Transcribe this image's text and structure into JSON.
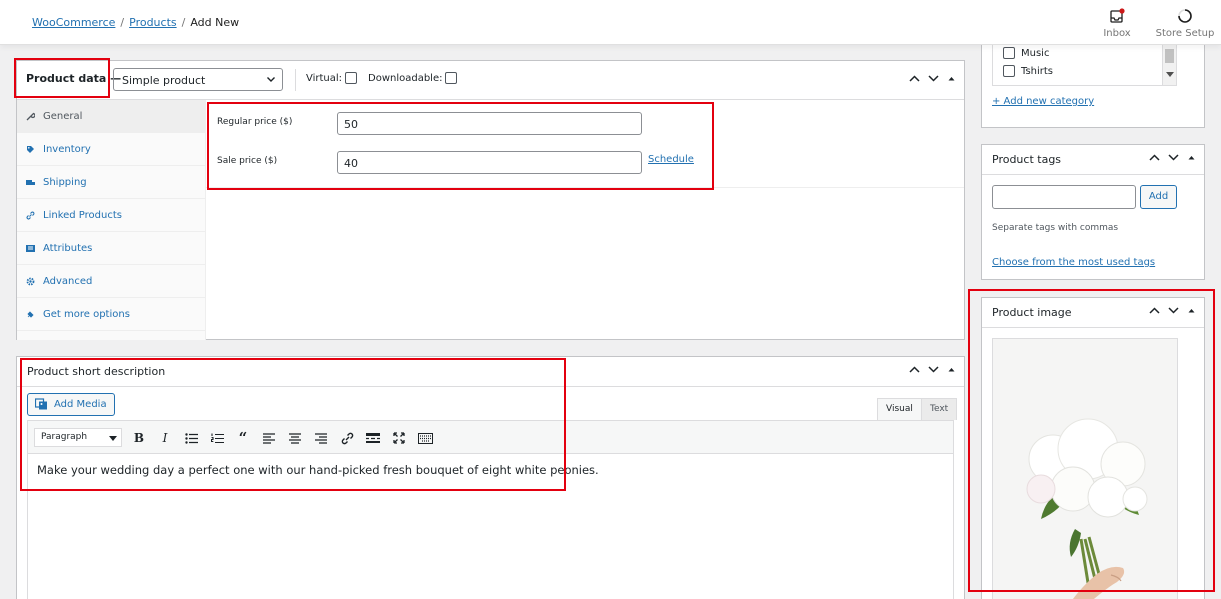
{
  "breadcrumb": {
    "items": [
      "WooCommerce",
      "Products"
    ],
    "current": "Add New",
    "separator": "/"
  },
  "header": {
    "inbox_label": "Inbox",
    "store_setup_label": "Store Setup"
  },
  "product_data": {
    "title": "Product data —",
    "type_selected": "Simple product",
    "virtual_label": "Virtual:",
    "downloadable_label": "Downloadable:",
    "tabs": [
      {
        "label": "General",
        "icon": "wrench-icon"
      },
      {
        "label": "Inventory",
        "icon": "tag-icon"
      },
      {
        "label": "Shipping",
        "icon": "truck-icon"
      },
      {
        "label": "Linked Products",
        "icon": "link-icon"
      },
      {
        "label": "Attributes",
        "icon": "list-icon"
      },
      {
        "label": "Advanced",
        "icon": "gear-icon"
      },
      {
        "label": "Get more options",
        "icon": "plugin-icon"
      }
    ],
    "regular_price_label": "Regular price ($)",
    "regular_price_value": "50",
    "sale_price_label": "Sale price ($)",
    "sale_price_value": "40",
    "schedule_label": "Schedule"
  },
  "short_description": {
    "title": "Product short description",
    "add_media_label": "Add Media",
    "visual_tab": "Visual",
    "text_tab": "Text",
    "format_selected": "Paragraph",
    "content": "Make your wedding day a perfect one with our hand-picked fresh bouquet of eight white peonies."
  },
  "categories": {
    "items": [
      "Music",
      "Tshirts"
    ],
    "add_link": "+ Add new category"
  },
  "product_tags": {
    "title": "Product tags",
    "add_label": "Add",
    "hint": "Separate tags with commas",
    "choose_link": "Choose from the most used tags"
  },
  "product_image": {
    "title": "Product image"
  },
  "colors": {
    "link": "#2271b1",
    "highlight": "#e3000f",
    "inbox_badge": "#cc1818"
  }
}
